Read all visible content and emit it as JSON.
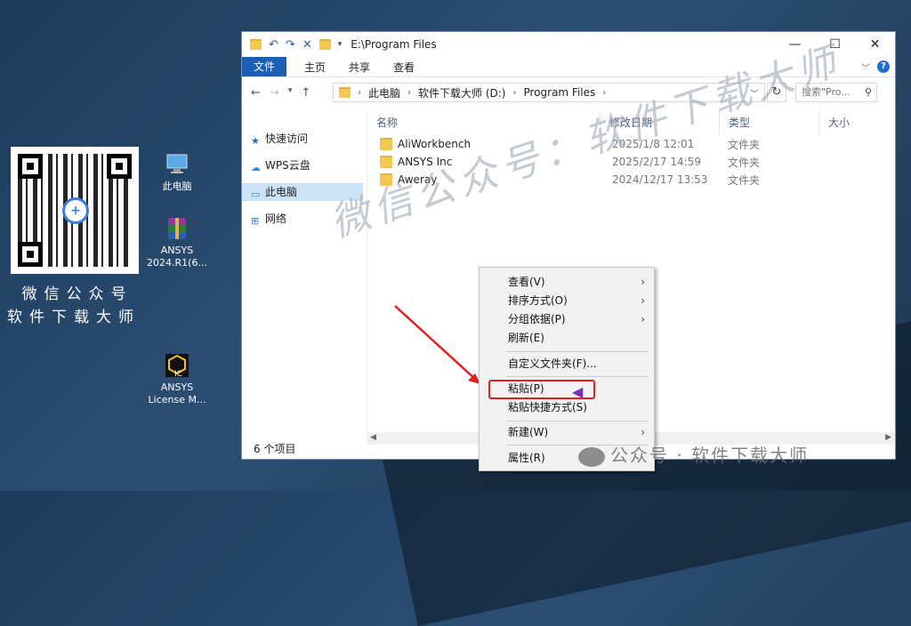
{
  "desktop": {
    "qr_caption_line1": "微信公众号",
    "qr_caption_line2": "软件下载大师",
    "icons": [
      {
        "label": "此电脑"
      },
      {
        "label": "ANSYS 2024.R1(6..."
      },
      {
        "label": "ANSYS License M..."
      }
    ]
  },
  "window": {
    "title": "E:\\Program Files",
    "ribbon_tabs": [
      "文件",
      "主页",
      "共享",
      "查看"
    ],
    "address": [
      "此电脑",
      "软件下载大师 (D:)",
      "Program Files"
    ],
    "search_placeholder": "搜索\"Pro...",
    "nav_items": [
      "快速访问",
      "WPS云盘",
      "此电脑",
      "网络"
    ],
    "columns": [
      "名称",
      "修改日期",
      "类型",
      "大小"
    ],
    "files": [
      {
        "name": "AliWorkbench",
        "date": "2025/1/8 12:01",
        "type": "文件夹"
      },
      {
        "name": "ANSYS Inc",
        "date": "2025/2/17 14:59",
        "type": "文件夹"
      },
      {
        "name": "Aweray",
        "date": "2024/12/17 13:53",
        "type": "文件夹"
      }
    ],
    "status": "6 个项目"
  },
  "context_menu": {
    "items": [
      {
        "label": "查看(V)",
        "submenu": true
      },
      {
        "label": "排序方式(O)",
        "submenu": true
      },
      {
        "label": "分组依据(P)",
        "submenu": true
      },
      {
        "label": "刷新(E)",
        "submenu": false
      },
      {
        "label": "自定义文件夹(F)...",
        "submenu": false
      },
      {
        "label": "粘贴(P)",
        "submenu": false,
        "highlighted": true
      },
      {
        "label": "粘贴快捷方式(S)",
        "submenu": false
      },
      {
        "label": "新建(W)",
        "submenu": true
      },
      {
        "label": "属性(R)",
        "submenu": false
      }
    ]
  },
  "watermark": {
    "diagonal": "微信公众号：软件下载大师",
    "bottom": "公众号 · 软件下载大师"
  },
  "colors": {
    "accent": "#1a5fb4",
    "highlight_box": "#e02020",
    "arrow": "#e02020"
  }
}
